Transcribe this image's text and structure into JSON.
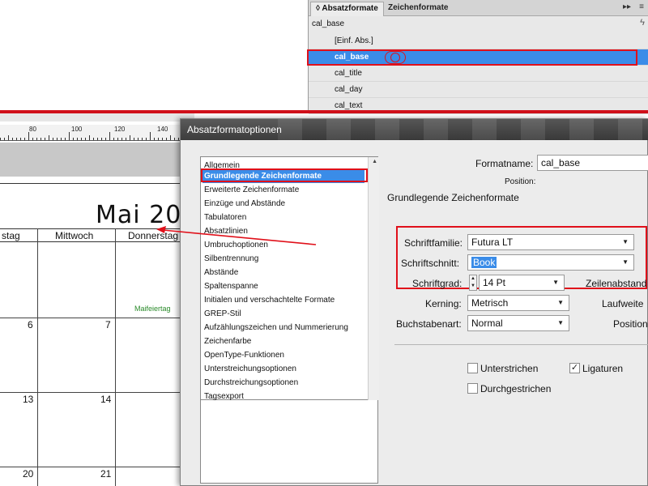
{
  "panel": {
    "tab_active": "◊ Absatzformate",
    "tab_other": "Zeichenformate",
    "menu_glyph": "▸▸",
    "menu_glyph2": "≡",
    "current_style": "cal_base",
    "bolt_glyph": "ϟ",
    "items": [
      "[Einf. Abs.]",
      "cal_base",
      "cal_title",
      "cal_day",
      "cal_text"
    ]
  },
  "calendar": {
    "ruler_labels": [
      "80",
      "100",
      "120",
      "140"
    ],
    "month_title": "Mai 20",
    "day_names": [
      "stag",
      "Mittwoch",
      "Donnerstag"
    ],
    "day_numbers": [
      "6",
      "7",
      "13",
      "14",
      "20",
      "21"
    ],
    "holiday_note": "Maifeiertag"
  },
  "dialog": {
    "title": "Absatzformatoptionen",
    "categories": [
      "Allgemein",
      "Grundlegende Zeichenformate",
      "Erweiterte Zeichenformate",
      "Einzüge und Abstände",
      "Tabulatoren",
      "Absatzlinien",
      "Umbruchoptionen",
      "Silbentrennung",
      "Abstände",
      "Spaltenspanne",
      "Initialen und verschachtelte Formate",
      "GREP-Stil",
      "Aufzählungszeichen und Nummerierung",
      "Zeichenfarbe",
      "OpenType-Funktionen",
      "Unterstreichungsoptionen",
      "Durchstreichungsoptionen",
      "Tagsexport"
    ],
    "formatname_label": "Formatname:",
    "formatname_value": "cal_base",
    "position_label": "Position:",
    "section_title": "Grundlegende Zeichenformate",
    "schriftfamilie_label": "Schriftfamilie:",
    "schriftfamilie_value": "Futura LT",
    "schriftschnitt_label": "Schriftschnitt:",
    "schriftschnitt_value": "Book",
    "schriftgrad_label": "Schriftgrad:",
    "schriftgrad_value": "14 Pt",
    "zeilenabstand_label": "Zeilenabstand",
    "kerning_label": "Kerning:",
    "kerning_value": "Metrisch",
    "laufweite_label": "Laufweite",
    "buchstabenart_label": "Buchstabenart:",
    "buchstabenart_value": "Normal",
    "position2_label": "Position",
    "unterstrichen_label": "Unterstrichen",
    "ligaturen_label": "Ligaturen",
    "durchgestrichen_label": "Durchgestrichen",
    "check_glyph": "✓"
  },
  "colors": {
    "highlight": "#3a8ce8",
    "annotation_red": "#e0101a",
    "holiday_green": "#2a8a2a"
  }
}
